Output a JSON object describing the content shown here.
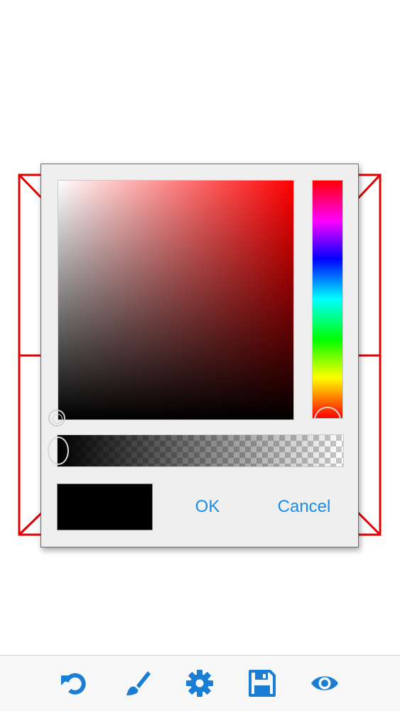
{
  "dialog": {
    "ok_label": "OK",
    "cancel_label": "Cancel",
    "selected_hue_color": "#ff0000",
    "current_color": "#000000",
    "button_color": "#1a8ce8"
  },
  "canvas": {
    "stroke_color": "#e30000"
  },
  "toolbar": {
    "icon_color": "#1a7fd4",
    "items": [
      {
        "icon": "undo-icon"
      },
      {
        "icon": "brush-icon"
      },
      {
        "icon": "gear-icon"
      },
      {
        "icon": "save-icon"
      },
      {
        "icon": "eye-icon"
      }
    ]
  }
}
